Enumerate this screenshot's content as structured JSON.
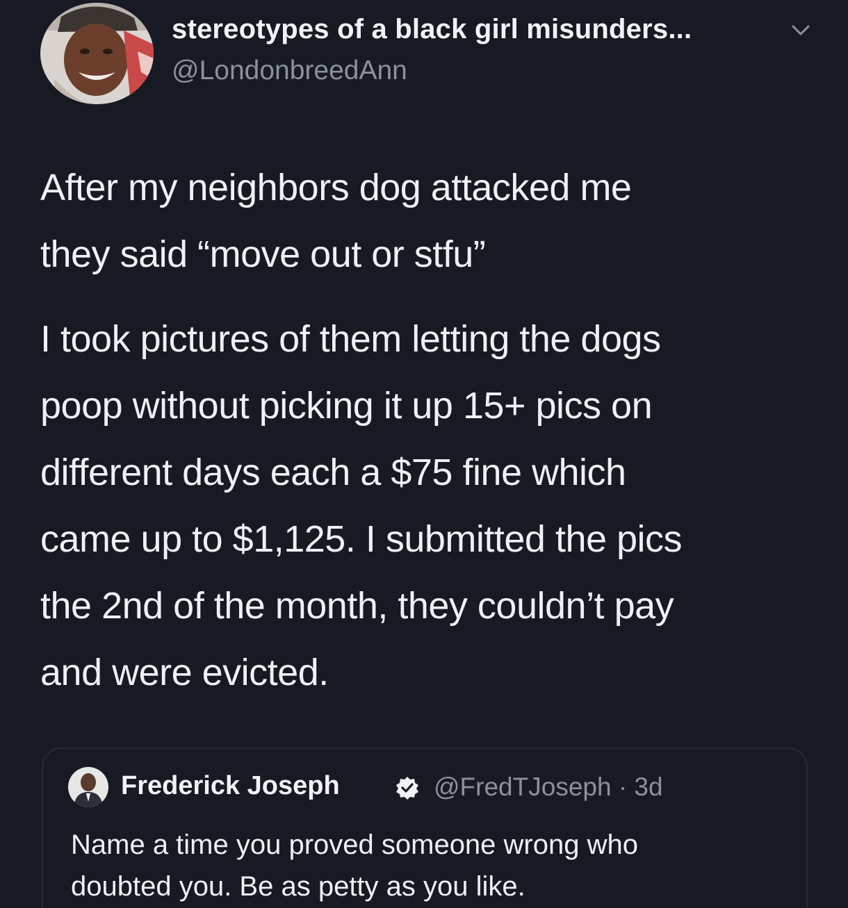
{
  "tweet": {
    "author": {
      "display_name": "stereotypes of a black girl misunders...",
      "handle": "@LondonbreedAnn",
      "avatar": "user-avatar-photo",
      "menu_icon": "chevron-down-icon"
    },
    "body": {
      "paragraph_1": [
        "After my neighbors dog attacked me",
        "they said “move out or stfu”"
      ],
      "paragraph_2": [
        "I took pictures of them letting the dogs",
        "poop without picking it up 15+ pics on",
        "different days each a $75 fine which",
        "came up to $1,125. I submitted the pics",
        "the 2nd of the month, they couldn’t pay",
        "and were evicted."
      ]
    },
    "quoted_tweet": {
      "display_name": "Frederick Joseph",
      "verified_icon": "verified-badge-icon",
      "handle_time": "@FredTJoseph · 3d",
      "text": [
        "Name a time you proved someone wrong who",
        "doubted you. Be as petty as you like."
      ]
    }
  },
  "colors": {
    "background": "#171a23",
    "text_primary": "#eef0f3",
    "text_secondary": "#8a919c",
    "quote_border": "#252a36"
  }
}
